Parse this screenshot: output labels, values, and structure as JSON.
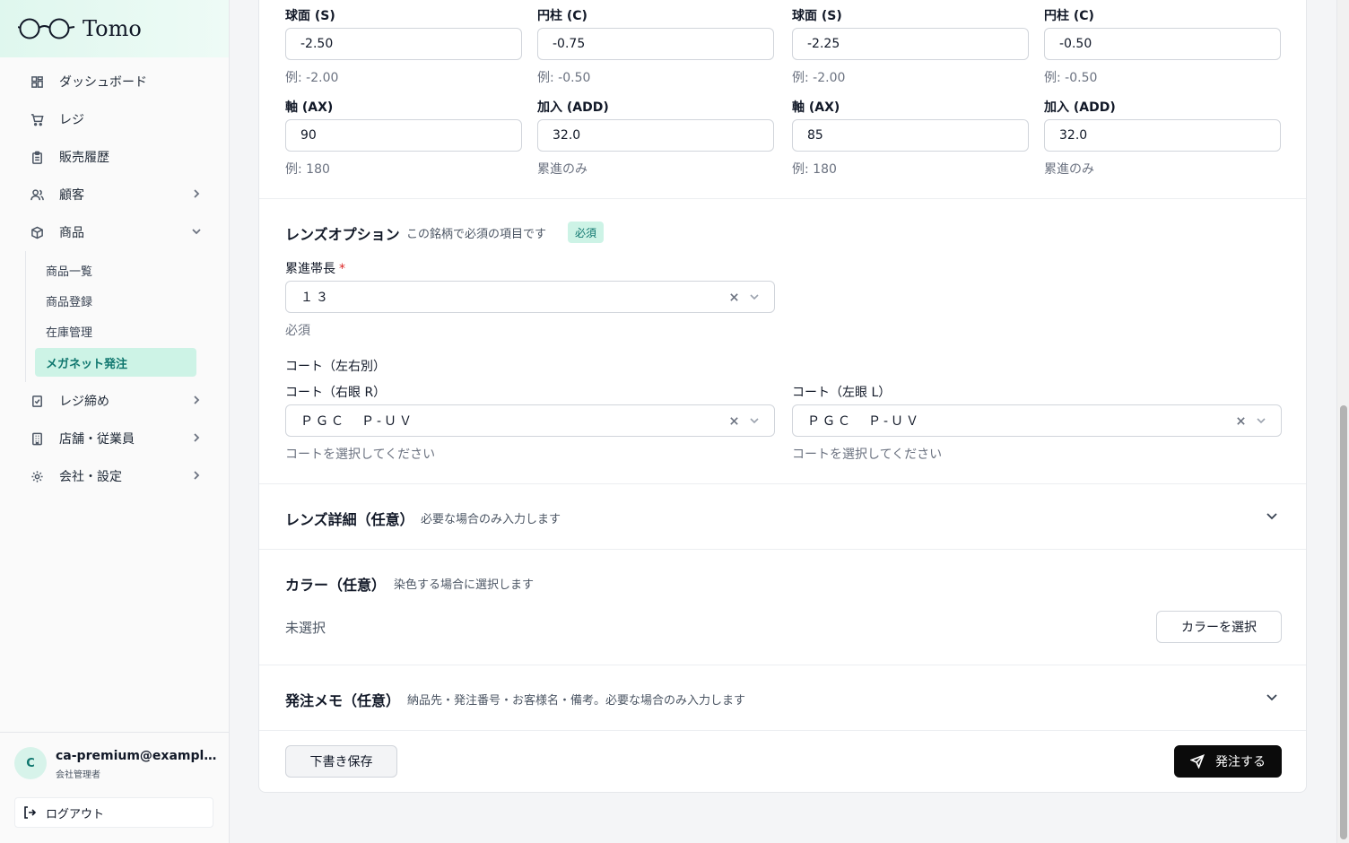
{
  "app": {
    "name": "Tomo"
  },
  "sidebar": {
    "items": [
      {
        "label": "ダッシュボード",
        "icon": "dashboard-icon"
      },
      {
        "label": "レジ",
        "icon": "cart-icon"
      },
      {
        "label": "販売履歴",
        "icon": "clipboard-icon"
      },
      {
        "label": "顧客",
        "icon": "users-icon"
      },
      {
        "label": "商品",
        "icon": "package-icon"
      },
      {
        "label": "レジ締め",
        "icon": "checklist-icon"
      },
      {
        "label": "店舗・従業員",
        "icon": "building-icon"
      },
      {
        "label": "会社・設定",
        "icon": "gear-icon"
      }
    ],
    "subitems": [
      "商品一覧",
      "商品登録",
      "在庫管理",
      "メガネット発注"
    ]
  },
  "user": {
    "initial": "C",
    "email": "ca-premium@example.com",
    "role": "会社管理者",
    "logout_label": "ログアウト"
  },
  "prescription": {
    "right": {
      "sph_label": "球面 (S)",
      "sph_value": "-2.50",
      "sph_hint": "例: -2.00",
      "cyl_label": "円柱 (C)",
      "cyl_value": "-0.75",
      "cyl_hint": "例: -0.50",
      "ax_label": "軸 (AX)",
      "ax_value": "90",
      "ax_hint": "例: 180",
      "add_label": "加入 (ADD)",
      "add_value": "32.0",
      "add_hint": "累進のみ"
    },
    "left": {
      "sph_label": "球面 (S)",
      "sph_value": "-2.25",
      "sph_hint": "例: -2.00",
      "cyl_label": "円柱 (C)",
      "cyl_value": "-0.50",
      "cyl_hint": "例: -0.50",
      "ax_label": "軸 (AX)",
      "ax_value": "85",
      "ax_hint": "例: 180",
      "add_label": "加入 (ADD)",
      "add_value": "32.0",
      "add_hint": "累進のみ"
    }
  },
  "lens_options": {
    "title": "レンズオプション",
    "subtitle": "この銘柄で必須の項目です",
    "badge": "必須",
    "corridor_label": "累進帯長",
    "corridor_required_mark": "*",
    "corridor_value": "１３",
    "corridor_hint": "必須",
    "coat_group_label": "コート（左右別）",
    "coat_right_label": "コート（右眼 R）",
    "coat_right_value": "ＰＧＣ　Ｐ-ＵＶ",
    "coat_right_hint": "コートを選択してください",
    "coat_left_label": "コート（左眼 L）",
    "coat_left_value": "ＰＧＣ　Ｐ-ＵＶ",
    "coat_left_hint": "コートを選択してください"
  },
  "lens_details": {
    "title": "レンズ詳細（任意）",
    "subtitle": "必要な場合のみ入力します"
  },
  "color": {
    "title": "カラー（任意）",
    "subtitle": "染色する場合に選択します",
    "value": "未選択",
    "button": "カラーを選択"
  },
  "memo": {
    "title": "発注メモ（任意）",
    "subtitle": "納品先・発注番号・お客様名・備考。必要な場合のみ入力します"
  },
  "actions": {
    "draft": "下書き保存",
    "submit": "発注する"
  }
}
